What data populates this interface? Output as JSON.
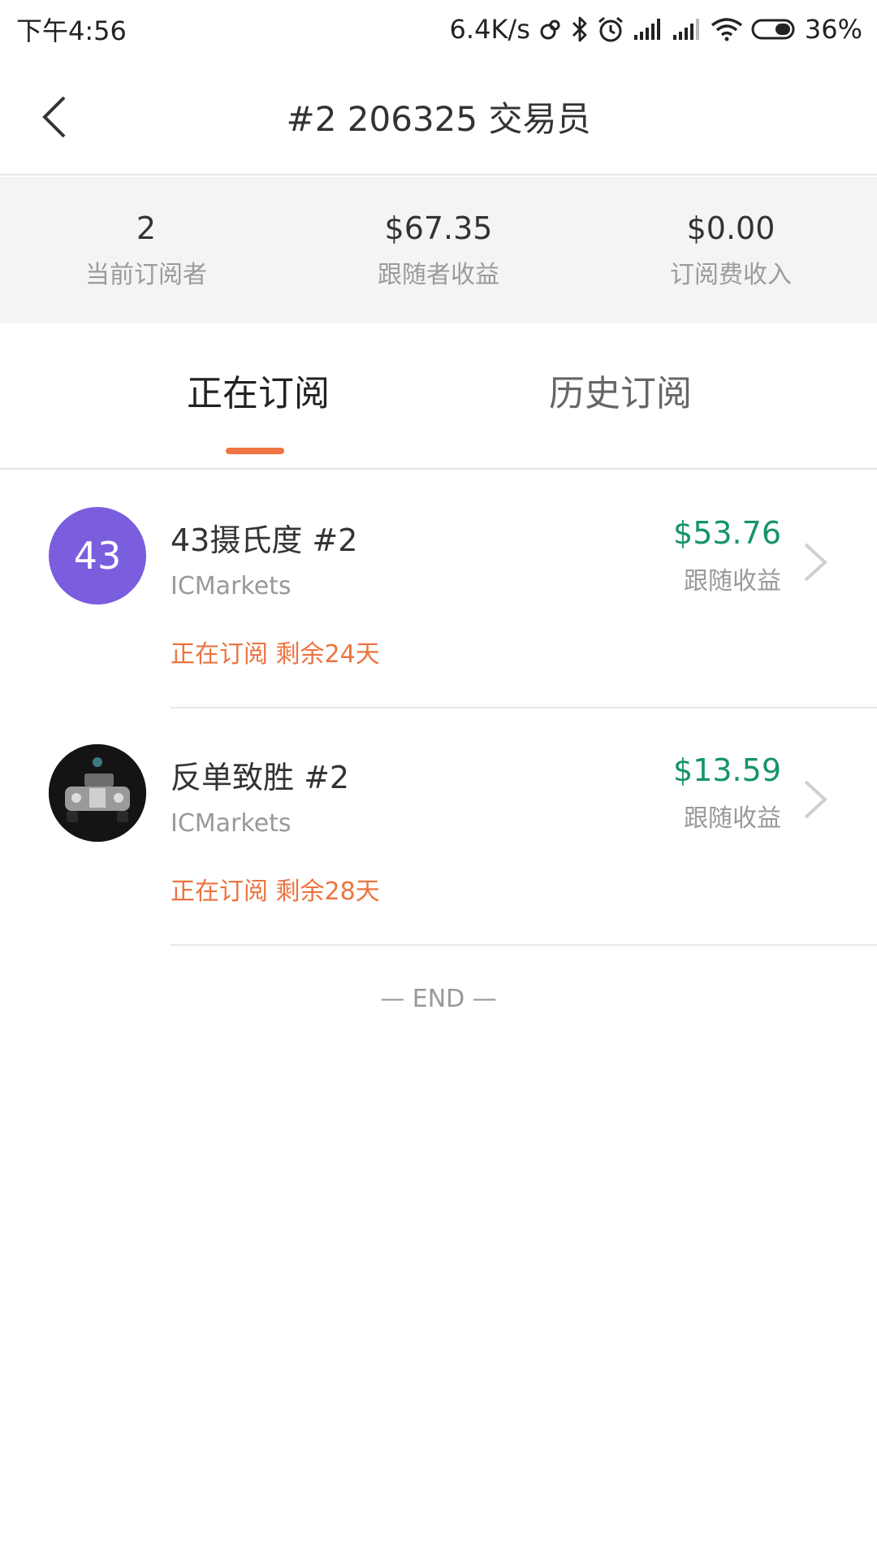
{
  "status_bar": {
    "time": "下午4:56",
    "network_speed": "6.4K/s",
    "battery": "36%"
  },
  "nav": {
    "title": "#2 206325 交易员"
  },
  "stats": [
    {
      "value": "2",
      "label": "当前订阅者"
    },
    {
      "value": "$67.35",
      "label": "跟随者收益"
    },
    {
      "value": "$0.00",
      "label": "订阅费收入"
    }
  ],
  "tabs": [
    {
      "label": "正在订阅",
      "active": true
    },
    {
      "label": "历史订阅",
      "active": false
    }
  ],
  "subscriptions": [
    {
      "avatar_text": "43",
      "avatar_color": "#7a5ede",
      "name": "43摄氏度  #2",
      "broker": "ICMarkets",
      "amount": "$53.76",
      "amount_label": "跟随收益",
      "status": "正在订阅 剩余24天"
    },
    {
      "avatar_text": "",
      "avatar_color": "#111111",
      "name": "反单致胜  #2",
      "broker": "ICMarkets",
      "amount": "$13.59",
      "amount_label": "跟随收益",
      "status": "正在订阅 剩余28天"
    }
  ],
  "end_text": "— END —",
  "colors": {
    "accent": "#f07545",
    "positive": "#16946b"
  }
}
